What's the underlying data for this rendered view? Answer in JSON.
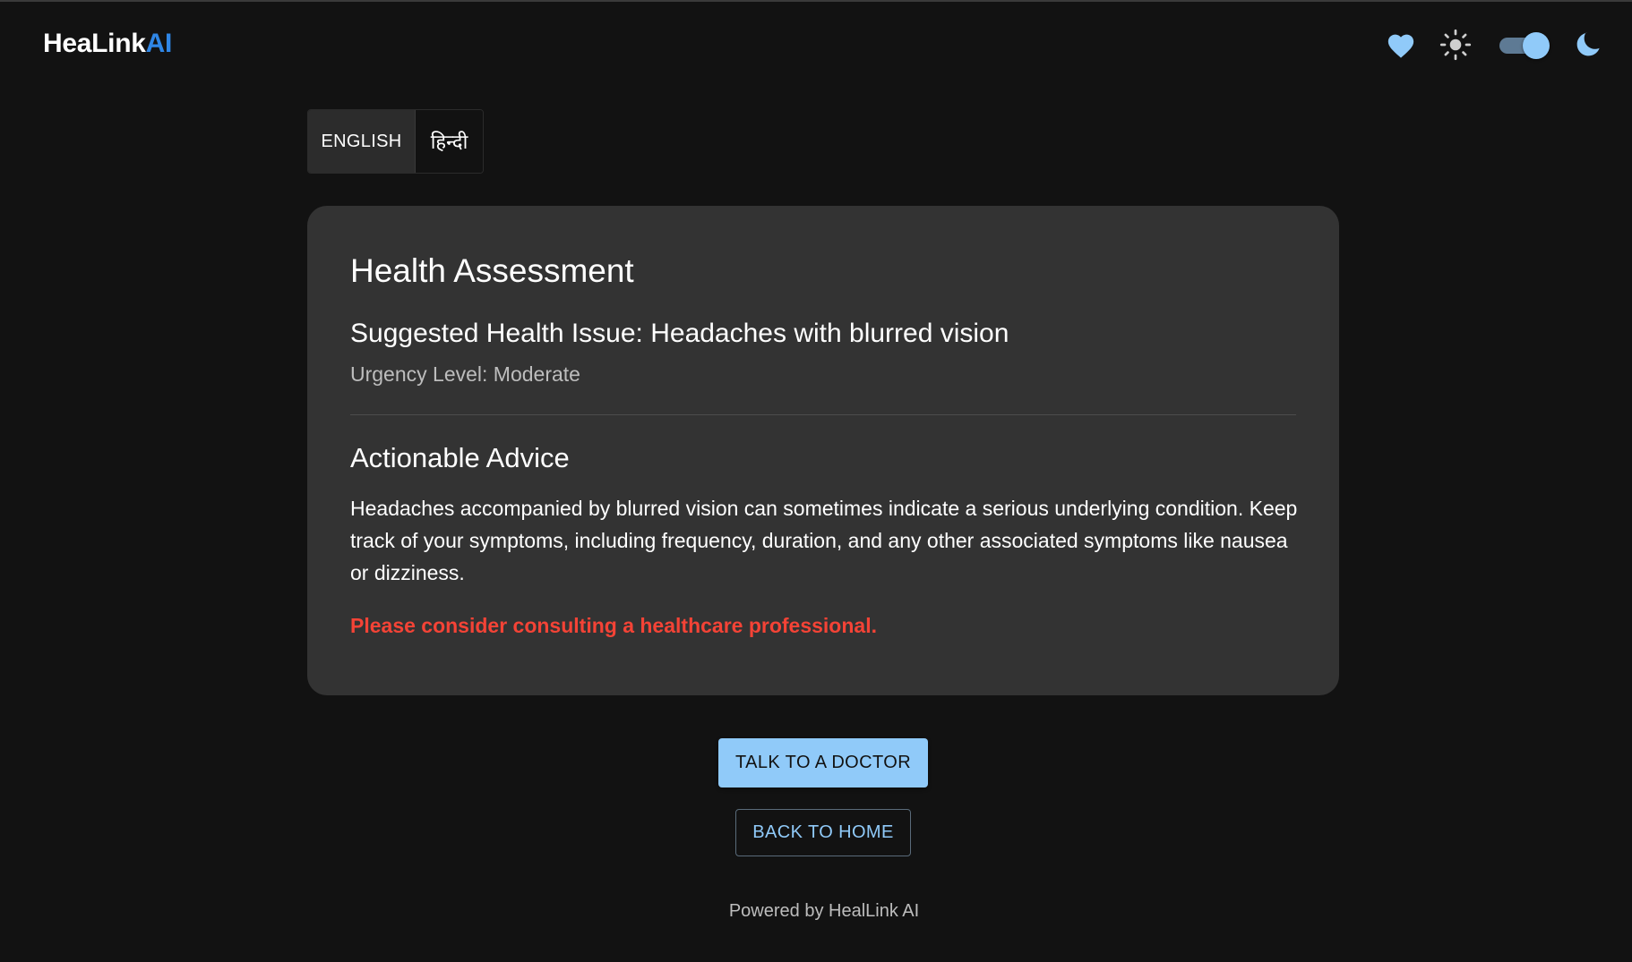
{
  "app": {
    "brand_main": "HeaLink",
    "brand_accent": "AI",
    "accent_color": "#2f86e6"
  },
  "nav": {
    "icons": [
      "heart-icon",
      "sun-icon",
      "theme-toggle",
      "moon-icon"
    ],
    "theme_toggle_on": true
  },
  "language": {
    "options": [
      {
        "label": "ENGLISH",
        "selected": true
      },
      {
        "label": "हिन्दी",
        "selected": false
      }
    ]
  },
  "assessment": {
    "title": "Health Assessment",
    "suggested_issue": "Suggested Health Issue: Headaches with blurred vision",
    "urgency": "Urgency Level: Moderate",
    "advice_heading": "Actionable Advice",
    "advice_text": "Headaches accompanied by blurred vision can sometimes indicate a serious underlying condition. Keep track of your symptoms, including frequency, duration, and any other associated symptoms like nausea or dizziness.",
    "warning": "Please consider consulting a healthcare professional.",
    "warning_color": "#f44336"
  },
  "actions": {
    "talk_label": "TALK TO A DOCTOR",
    "back_label": "BACK TO HOME"
  },
  "footer": {
    "text": "Powered by HealLink AI"
  }
}
